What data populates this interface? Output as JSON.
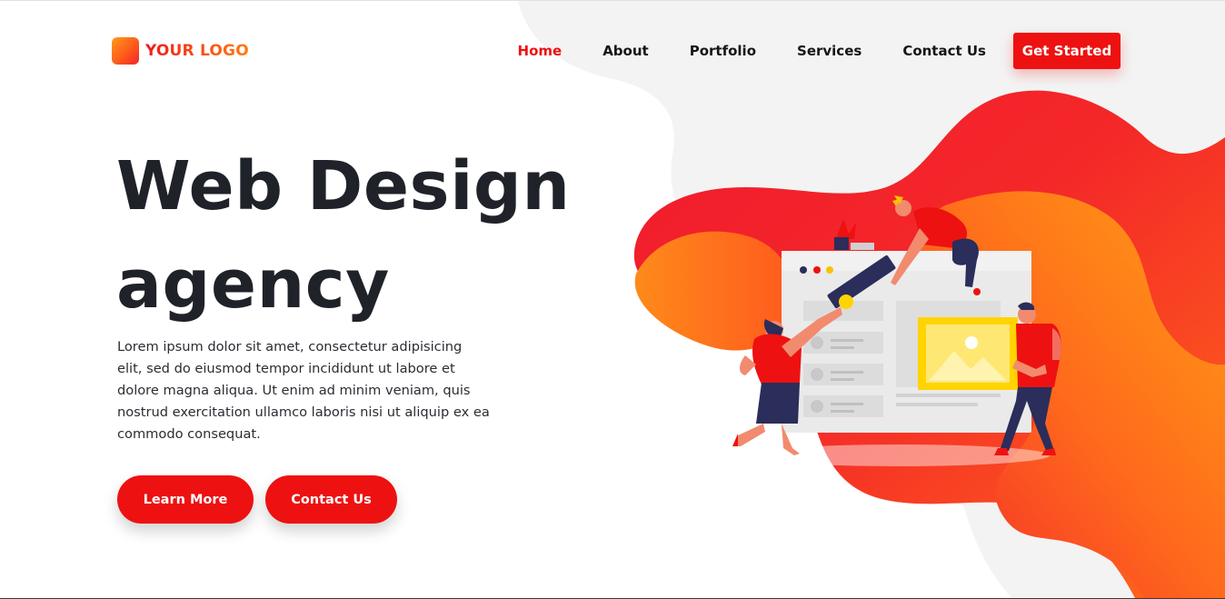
{
  "brand": {
    "logo_text": "YOUR LOGO"
  },
  "nav": {
    "items": [
      {
        "label": "Home",
        "active": true
      },
      {
        "label": "About",
        "active": false
      },
      {
        "label": "Portfolio",
        "active": false
      },
      {
        "label": "Services",
        "active": false
      },
      {
        "label": "Contact Us",
        "active": false
      }
    ],
    "cta_label": "Get Started"
  },
  "hero": {
    "title_line1": "Web Design",
    "title_line2": "agency",
    "description": "Lorem ipsum dolor sit amet, consectetur adipisicing elit, sed do eiusmod tempor incididunt ut labore et dolore magna aliqua. Ut enim ad minim veniam, quis nostrud exercitation ullamco laboris nisi ut aliquip ex ea commodo consequat.",
    "primary_button": "Learn More",
    "secondary_button": "Contact Us"
  },
  "colors": {
    "accent": "#ee1111",
    "heading": "#1f2229",
    "gradient_start": "#ff9a1f",
    "gradient_end": "#f0252c",
    "blob_grey": "#f3f3f3"
  },
  "illustration": {
    "icon": "web-design-team-illustration"
  }
}
